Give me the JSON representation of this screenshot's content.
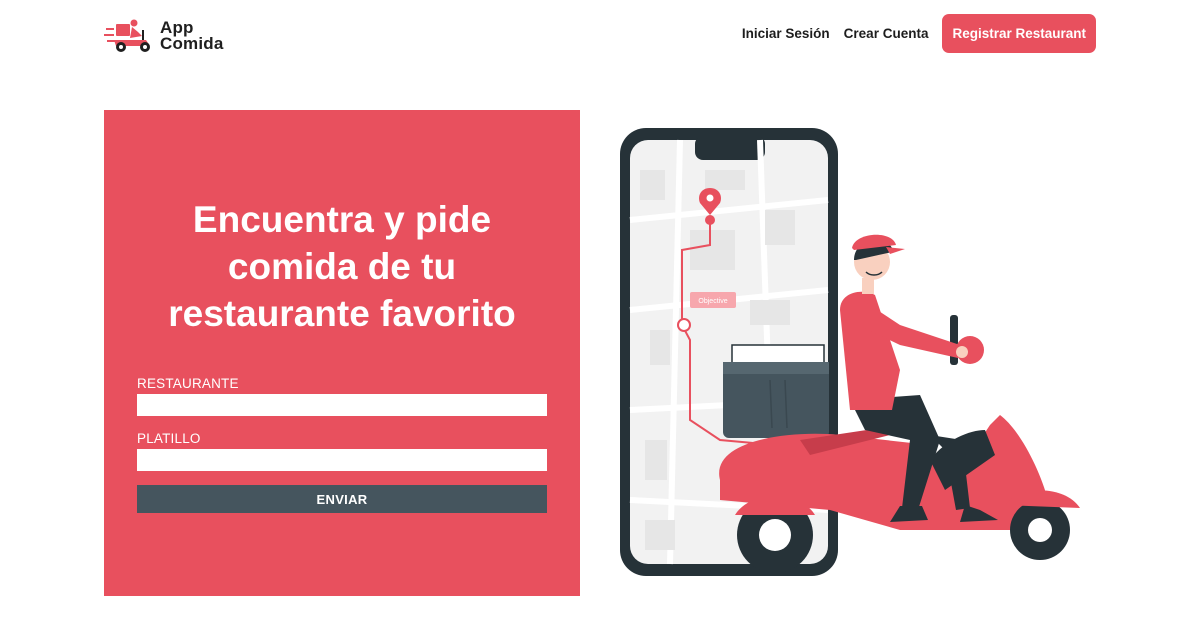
{
  "brand": {
    "name_line1": "App",
    "name_line2": "Comida",
    "accent_color": "#e8505e",
    "icon": "delivery-scooter-icon"
  },
  "nav": {
    "login_label": "Iniciar Sesión",
    "signup_label": "Crear Cuenta",
    "register_label": "Registrar Restaurant"
  },
  "hero": {
    "title": "Encuentra y pide comida de tu restaurante favorito",
    "background_color": "#e8505e",
    "form": {
      "restaurant_label": "RESTAURANTE",
      "restaurant_value": "",
      "dish_label": "PLATILLO",
      "dish_value": "",
      "submit_label": "ENVIAR",
      "submit_color": "#45555e"
    }
  },
  "illustration": {
    "map_tag": "Objective",
    "subject": "delivery-courier-illustration"
  }
}
